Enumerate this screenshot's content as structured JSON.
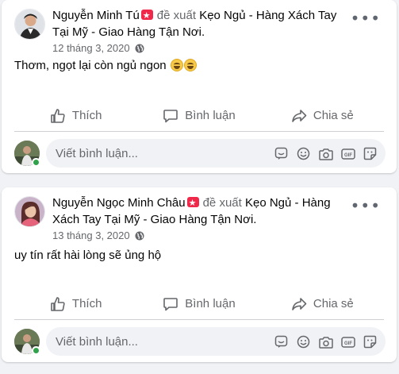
{
  "posts": [
    {
      "author": "Nguyễn Minh Tú",
      "verb": "đề xuất",
      "page": "Kẹo Ngủ - Hàng Xách Tay Tại Mỹ - Giao Hàng Tận Nơi.",
      "date": "12 tháng 3, 2020",
      "body": "Thơm, ngọt lại còn ngủ ngon",
      "body_emoji": [
        "grinning-face",
        "grinning-face"
      ],
      "actions": {
        "like": "Thích",
        "comment": "Bình luận",
        "share": "Chia sẻ"
      },
      "comment_placeholder": "Viết bình luận..."
    },
    {
      "author": "Nguyễn Ngọc Minh Châu",
      "verb": "đề xuất",
      "page": "Kẹo Ngủ - Hàng Xách Tay Tại Mỹ - Giao Hàng Tận Nơi.",
      "date": "13 tháng 3, 2020",
      "body": "uy tín rất hài lòng sẽ ủng hộ",
      "actions": {
        "like": "Thích",
        "comment": "Bình luận",
        "share": "Chia sẻ"
      },
      "comment_placeholder": "Viết bình luận..."
    }
  ],
  "icons": {
    "recommend_badge": "recommendation-star-icon",
    "privacy": "globe-icon",
    "more": "more-options-icon",
    "comment_tools": [
      "sticker-comment-icon",
      "emoji-icon",
      "camera-icon",
      "gif-icon",
      "sticker-icon"
    ]
  },
  "colors": {
    "badge": "#f02849",
    "secondary_text": "#65676b",
    "online": "#31a24c"
  }
}
